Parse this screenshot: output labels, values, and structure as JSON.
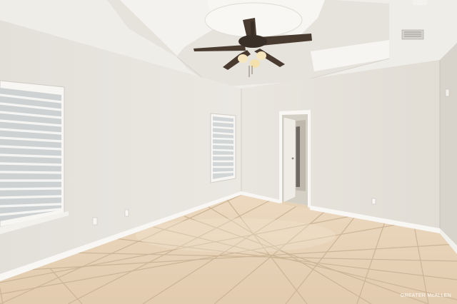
{
  "photo": {
    "watermark": "GREATER McALLEN",
    "colors": {
      "wall": "#e7e4de",
      "wall_shadow": "#d9d5cd",
      "ceiling": "#f1efea",
      "floor_tile": "#e8d3b8",
      "grout": "#cfb89b",
      "baseboard": "#f7f6f2",
      "fan_blade": "#4a3b30",
      "fan_light": "#f5e6bd"
    }
  }
}
